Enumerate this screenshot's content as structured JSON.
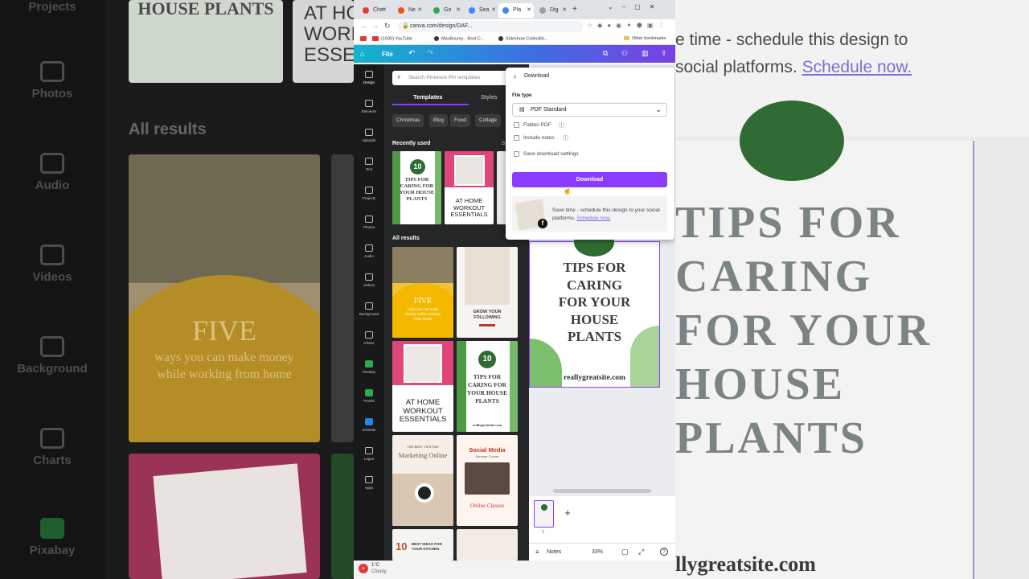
{
  "background_left": {
    "nav": [
      "Projects",
      "Photos",
      "Audio",
      "Videos",
      "Background",
      "Charts",
      "Pixabay"
    ],
    "section_title": "All results",
    "card_top_left": "HOUSE PLANTS",
    "card_top_right": "AT HOME WORKOUT ESSENTIALS",
    "card_big_title": "FIVE",
    "card_big_sub": "ways you can make money while working from home"
  },
  "background_right": {
    "banner_line1": "e time - schedule this design to",
    "banner_line2": "social platforms.",
    "banner_link": "Schedule now.",
    "big_lines": [
      "TIPS FOR",
      "CARING",
      "FOR YOUR",
      "HOUSE",
      "PLANTS"
    ],
    "site": "llygreatsite.com"
  },
  "browser": {
    "tabs": [
      "Che",
      "Ne",
      "Go",
      "Sea",
      "Pla",
      "Dig"
    ],
    "url": "canva.com/design/DAF...",
    "bookmarks": [
      "(1030) YouTube",
      "MaxBounty - Best C...",
      "Sideshow Collectibl...",
      "Other bookmarks"
    ]
  },
  "canva": {
    "file": "File",
    "rail": [
      "Design",
      "Elements",
      "Uploads",
      "Text",
      "Projects",
      "Photos",
      "Audio",
      "Videos",
      "Background",
      "Charts",
      "Pixabay",
      "Pexels",
      "Embeds",
      "Logos",
      "Apps"
    ],
    "search_placeholder": "Search Pinterest Pin templates",
    "tabs": {
      "templates": "Templates",
      "styles": "Styles"
    },
    "chips": [
      "Christmas",
      "Blog",
      "Food",
      "Collage"
    ],
    "recently_used": "Recently used",
    "see_all": "S",
    "all_results": "All results",
    "thumbs": {
      "t1_num": "10",
      "t1_text": "TIPS FOR CARING FOR YOUR HOUSE PLANTS",
      "t2_text": "AT HOME WORKOUT ESSENTIALS",
      "t3_title": "FIVE",
      "t3_sub": "ways you can make money while working from home",
      "t4_text": "GROW YOUR FOLLOWING",
      "t5_text": "AT HOME WORKOUT ESSENTIALS",
      "t6_num": "10",
      "t6_text": "TIPS FOR CARING FOR YOUR HOUSE PLANTS",
      "t6_site": "reallygreatsite.com",
      "t7_small": "THE BEST TIPS FOR",
      "t7_title": "Marketing Online",
      "t8_title": "Social Media",
      "t8_sub": "Summer Course",
      "t8_script": "Online Classes",
      "t9_num": "10",
      "t9_text": "BEST IDEAS FOR YOUR KITCHEN"
    },
    "design": {
      "lines": [
        "TIPS FOR",
        "CARING",
        "FOR YOUR",
        "HOUSE",
        "PLANTS"
      ],
      "site": "reallygreatsite.com"
    },
    "page_number": "1",
    "notes": "Notes",
    "zoom": "33%"
  },
  "download_panel": {
    "title": "Download",
    "file_type_label": "File type",
    "file_type_value": "PDF Standard",
    "flatten": "Flatten PDF",
    "include_notes": "Include notes",
    "save_settings": "Save download settings",
    "button": "Download",
    "promo_text": "Save time - schedule this design to your social platforms.",
    "promo_link": "Schedule now."
  },
  "taskbar": {
    "temp": "1°C",
    "weather": "Cloudy"
  },
  "colors": {
    "purple": "#8b3dff",
    "canva_teal": "#12b5cb",
    "plant_green": "#3f8f3c"
  }
}
